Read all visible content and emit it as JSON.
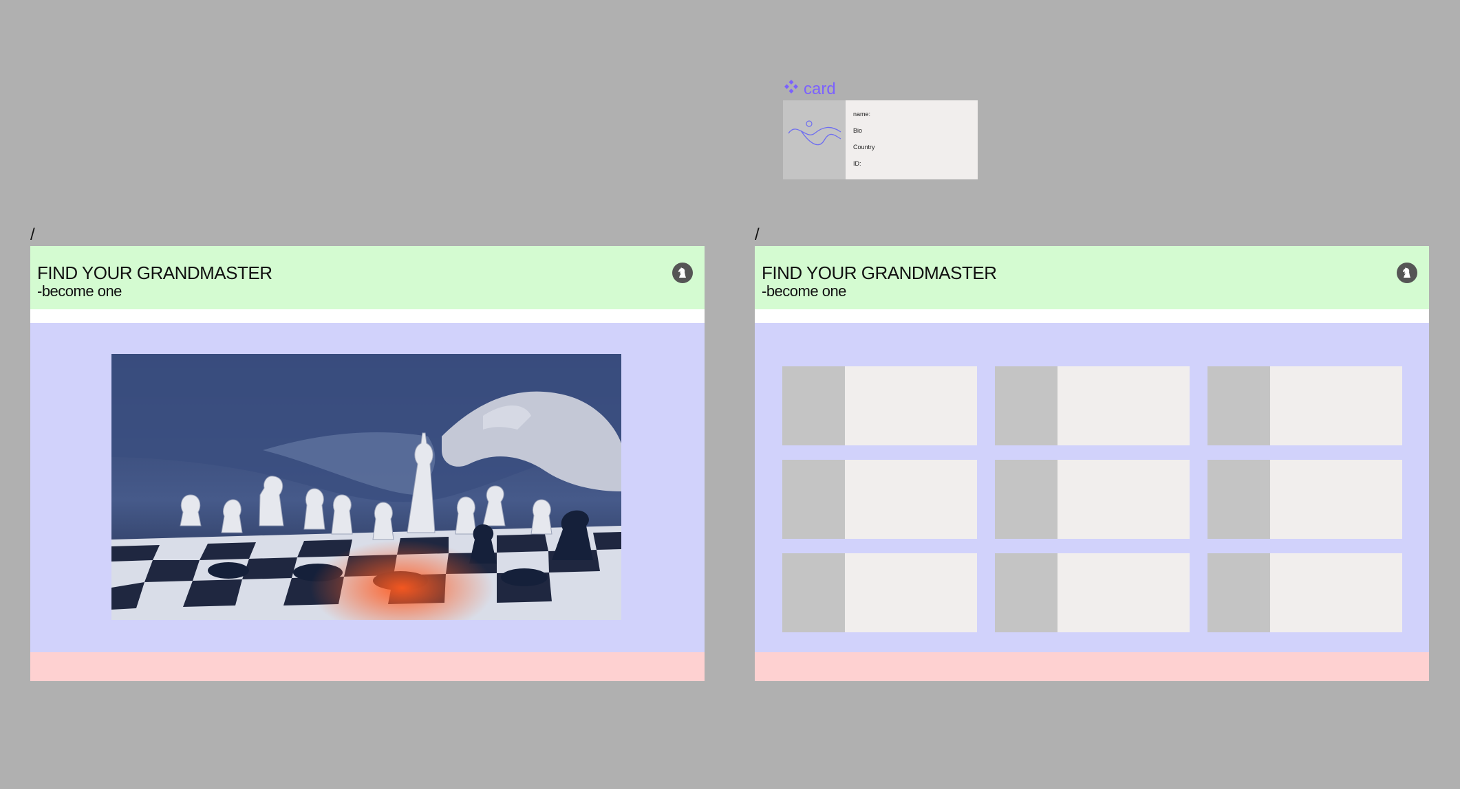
{
  "component": {
    "label": "card",
    "fields": [
      "name:",
      "Bio",
      "Country",
      "ID:"
    ]
  },
  "frames": [
    {
      "label": "/",
      "header": {
        "title": "FIND YOUR GRANDMASTER",
        "subtitle": "-become one",
        "icon": "chess-knight-icon"
      }
    },
    {
      "label": "/",
      "header": {
        "title": "FIND YOUR GRANDMASTER",
        "subtitle": "-become one",
        "icon": "chess-knight-icon"
      }
    }
  ],
  "colors": {
    "canvas": "#b0b0b0",
    "header": "#d4fbd1",
    "content": "#d1d2fb",
    "footer": "#fed1d1",
    "card": "#f1eeed",
    "card_thumb": "#c4c4c4",
    "component_accent": "#7b61ff"
  }
}
